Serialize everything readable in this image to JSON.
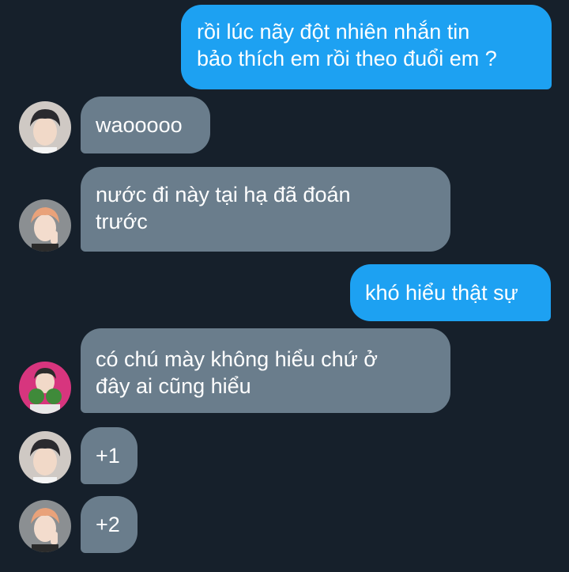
{
  "messages": [
    {
      "direction": "outgoing",
      "text": "rồi lúc nãy đột nhiên nhắn tin\nbảo thích em rồi theo đuổi em ?"
    },
    {
      "direction": "incoming",
      "avatar": "avatar-boy-dark-hair",
      "text": "waooooo"
    },
    {
      "direction": "incoming",
      "avatar": "avatar-boy-orange-hair",
      "text": "nước đi này tại hạ đã đoán\ntrước"
    },
    {
      "direction": "outgoing",
      "text": "khó hiểu thật sự"
    },
    {
      "direction": "incoming",
      "avatar": "avatar-boy-pink-background",
      "text": "có chú mày không hiểu chứ ở\nđây ai cũng hiểu"
    },
    {
      "direction": "incoming",
      "avatar": "avatar-boy-dark-hair",
      "text": "+1"
    },
    {
      "direction": "incoming",
      "avatar": "avatar-boy-orange-hair",
      "text": "+2"
    }
  ],
  "colors": {
    "background": "#16202b",
    "outgoing_bubble": "#1da1f2",
    "incoming_bubble": "#6a7d8c",
    "text": "#ffffff"
  }
}
